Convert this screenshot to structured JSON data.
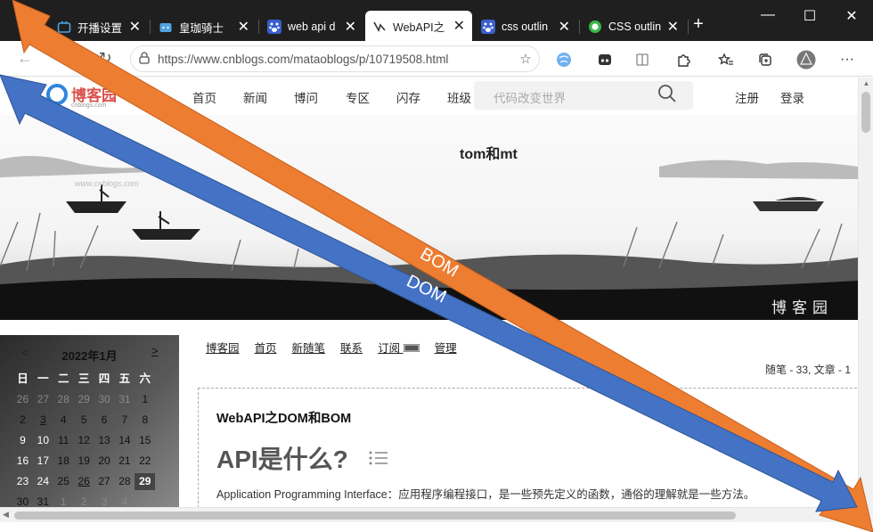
{
  "browser": {
    "tabs": [
      {
        "title": "开播设置",
        "icon": "bilibili-tv-icon"
      },
      {
        "title": "皇珈骑士",
        "icon": "bilibili-icon"
      },
      {
        "title": "web api d",
        "icon": "baidu-paw-icon"
      },
      {
        "title": "WebAPI之",
        "icon": "cnblogs-icon",
        "active": true
      },
      {
        "title": "css outlin",
        "icon": "baidu-paw-icon"
      },
      {
        "title": "CSS outlin",
        "icon": "green-ring-icon"
      }
    ],
    "new_tab_label": "+",
    "tab_close_label": "✕",
    "window_controls": {
      "minimize": "—",
      "maximize": "☐",
      "close": "✕"
    },
    "url": "https://www.cnblogs.com/mataoblogs/p/10719508.html"
  },
  "site": {
    "logo_text": "博客园",
    "logo_sub": "cnblogs.com",
    "nav": [
      "首页",
      "新闻",
      "博问",
      "专区",
      "闪存",
      "班级"
    ],
    "search_placeholder": "代码改变世界",
    "register": "注册",
    "login": "登录"
  },
  "banner": {
    "title": "tom和mt",
    "watermark": "www.cnblogs.com",
    "signature": "博客园"
  },
  "calendar": {
    "month_label": "2022年1月",
    "prev": "<",
    "next": ">",
    "weekdays": [
      "日",
      "一",
      "二",
      "三",
      "四",
      "五",
      "六"
    ],
    "days": [
      [
        "26",
        "27",
        "28",
        "29",
        "30",
        "31",
        "1"
      ],
      [
        "2",
        "3",
        "4",
        "5",
        "6",
        "7",
        "8"
      ],
      [
        "9",
        "10",
        "11",
        "12",
        "13",
        "14",
        "15"
      ],
      [
        "16",
        "17",
        "18",
        "19",
        "20",
        "21",
        "22"
      ],
      [
        "23",
        "24",
        "25",
        "26",
        "27",
        "28",
        "29"
      ],
      [
        "30",
        "31",
        "1",
        "2",
        "3",
        "4",
        ""
      ]
    ],
    "today": "29"
  },
  "blog_menu": [
    "博客园",
    "首页",
    "新随笔",
    "联系",
    "订阅",
    "管理"
  ],
  "stats": "随笔 - 33,  文章 - 1",
  "post": {
    "title": "WebAPI之DOM和BOM",
    "heading": "API是什么?",
    "paragraph": "Application Programming Interface：应用程序编程接口，是一些预先定义的函数，通俗的理解就是一些方法。"
  },
  "annotations": {
    "arrow_orange_label": "BOM",
    "arrow_blue_label": "DOM",
    "orange": "#ED7D31",
    "blue": "#4472C4"
  }
}
